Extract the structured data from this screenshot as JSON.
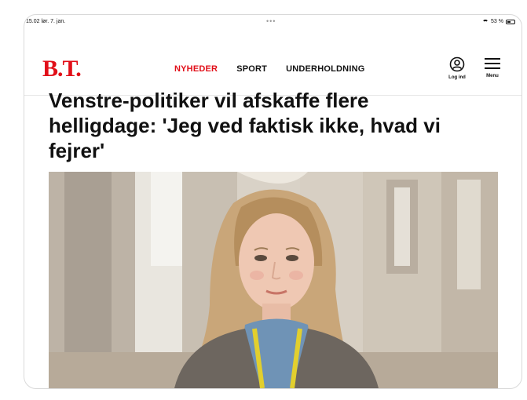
{
  "status_bar": {
    "time_date": "15.02  lør. 7. jan.",
    "dots": "•••",
    "battery": "53 %",
    "battery_level": 0.53
  },
  "header": {
    "logo": "B.T.",
    "nav": [
      {
        "label": "NYHEDER",
        "active": true
      },
      {
        "label": "SPORT",
        "active": false
      },
      {
        "label": "UNDERHOLDNING",
        "active": false
      }
    ],
    "login_label": "Log ind",
    "menu_label": "Menu",
    "brand_color": "#e10e18"
  },
  "article": {
    "headline": "Venstre-politiker vil afskaffe flere helligdage: 'Jeg ved faktisk ikke, hvad vi fejrer'"
  },
  "icons": {
    "login": "user-circle-icon",
    "menu": "hamburger-menu-icon",
    "wifi": "wifi-icon",
    "battery": "battery-icon"
  }
}
